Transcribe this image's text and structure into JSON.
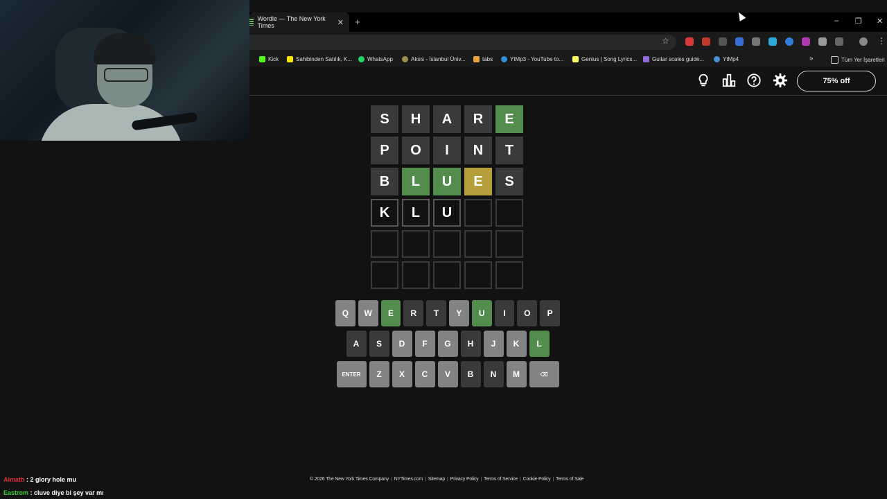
{
  "browser": {
    "tab_title": "Wordle — The New York Times",
    "tab_close": "✕",
    "new_tab": "+",
    "window_controls": [
      "–",
      "❐",
      "✕"
    ],
    "bookmarks": [
      {
        "label": "Kick",
        "color": "#53fc18"
      },
      {
        "label": "Sahibinden Satılık, K...",
        "color": "#ffe800"
      },
      {
        "label": "WhatsApp",
        "color": "#25d366"
      },
      {
        "label": "Aksis - İstanbul Üniv...",
        "color": "#9a8f4a"
      },
      {
        "label": "tabs",
        "color": "#e8a33d"
      },
      {
        "label": "YtMp3 - YouTube to...",
        "color": "#2f8fd8"
      },
      {
        "label": "Genius | Song Lyrics...",
        "color": "#ffff64"
      },
      {
        "label": "Guitar scales guide...",
        "color": "#8f6ad8"
      },
      {
        "label": "YtMp4",
        "color": "#4a8fd8"
      }
    ],
    "bookmarks_more": "»",
    "all_bookmarks": "Tüm Yer İşaretleri"
  },
  "header": {
    "subscribe_label": "75% off"
  },
  "board": [
    [
      {
        "l": "S",
        "s": "absent"
      },
      {
        "l": "H",
        "s": "absent"
      },
      {
        "l": "A",
        "s": "absent"
      },
      {
        "l": "R",
        "s": "absent"
      },
      {
        "l": "E",
        "s": "correct"
      }
    ],
    [
      {
        "l": "P",
        "s": "absent"
      },
      {
        "l": "O",
        "s": "absent"
      },
      {
        "l": "I",
        "s": "absent"
      },
      {
        "l": "N",
        "s": "absent"
      },
      {
        "l": "T",
        "s": "absent"
      }
    ],
    [
      {
        "l": "B",
        "s": "absent"
      },
      {
        "l": "L",
        "s": "correct"
      },
      {
        "l": "U",
        "s": "correct"
      },
      {
        "l": "E",
        "s": "present"
      },
      {
        "l": "S",
        "s": "absent"
      }
    ],
    [
      {
        "l": "K",
        "s": "tbd"
      },
      {
        "l": "L",
        "s": "tbd"
      },
      {
        "l": "U",
        "s": "tbd"
      },
      {
        "l": "",
        "s": "empty"
      },
      {
        "l": "",
        "s": "empty"
      }
    ],
    [
      {
        "l": "",
        "s": "empty"
      },
      {
        "l": "",
        "s": "empty"
      },
      {
        "l": "",
        "s": "empty"
      },
      {
        "l": "",
        "s": "empty"
      },
      {
        "l": "",
        "s": "empty"
      }
    ],
    [
      {
        "l": "",
        "s": "empty"
      },
      {
        "l": "",
        "s": "empty"
      },
      {
        "l": "",
        "s": "empty"
      },
      {
        "l": "",
        "s": "empty"
      },
      {
        "l": "",
        "s": "empty"
      }
    ]
  ],
  "keyboard": [
    [
      {
        "k": "Q",
        "s": "unused"
      },
      {
        "k": "W",
        "s": "unused"
      },
      {
        "k": "E",
        "s": "correct"
      },
      {
        "k": "R",
        "s": "absent"
      },
      {
        "k": "T",
        "s": "absent"
      },
      {
        "k": "Y",
        "s": "unused"
      },
      {
        "k": "U",
        "s": "correct"
      },
      {
        "k": "I",
        "s": "absent"
      },
      {
        "k": "O",
        "s": "absent"
      },
      {
        "k": "P",
        "s": "absent"
      }
    ],
    [
      {
        "k": "A",
        "s": "absent"
      },
      {
        "k": "S",
        "s": "absent"
      },
      {
        "k": "D",
        "s": "unused"
      },
      {
        "k": "F",
        "s": "unused"
      },
      {
        "k": "G",
        "s": "unused"
      },
      {
        "k": "H",
        "s": "absent"
      },
      {
        "k": "J",
        "s": "unused"
      },
      {
        "k": "K",
        "s": "unused"
      },
      {
        "k": "L",
        "s": "correct"
      }
    ],
    [
      {
        "k": "ENTER",
        "s": "unused",
        "wide": true
      },
      {
        "k": "Z",
        "s": "unused"
      },
      {
        "k": "X",
        "s": "unused"
      },
      {
        "k": "C",
        "s": "unused"
      },
      {
        "k": "V",
        "s": "unused"
      },
      {
        "k": "B",
        "s": "absent"
      },
      {
        "k": "N",
        "s": "absent"
      },
      {
        "k": "M",
        "s": "unused"
      },
      {
        "k": "⌫",
        "s": "unused",
        "wide": true
      }
    ]
  ],
  "footer": {
    "copyright": "© 2026 The New York Times Company",
    "links": [
      "NYTimes.com",
      "Sitemap",
      "Privacy Policy",
      "Terms of Service",
      "Cookie Policy",
      "Terms of Sale"
    ]
  },
  "chat": [
    {
      "user": "Aimath",
      "color": "#e0303a",
      "message": " : 2 glory hole mu"
    },
    {
      "user": "Eastrom",
      "color": "#3ad13a",
      "message": " : cluve diye bi şey var mı"
    }
  ],
  "colors": {
    "correct": "#538d4e",
    "present": "#b59f3b",
    "absent": "#3a3a3c",
    "unused_key": "#818384",
    "background": "#121213"
  }
}
